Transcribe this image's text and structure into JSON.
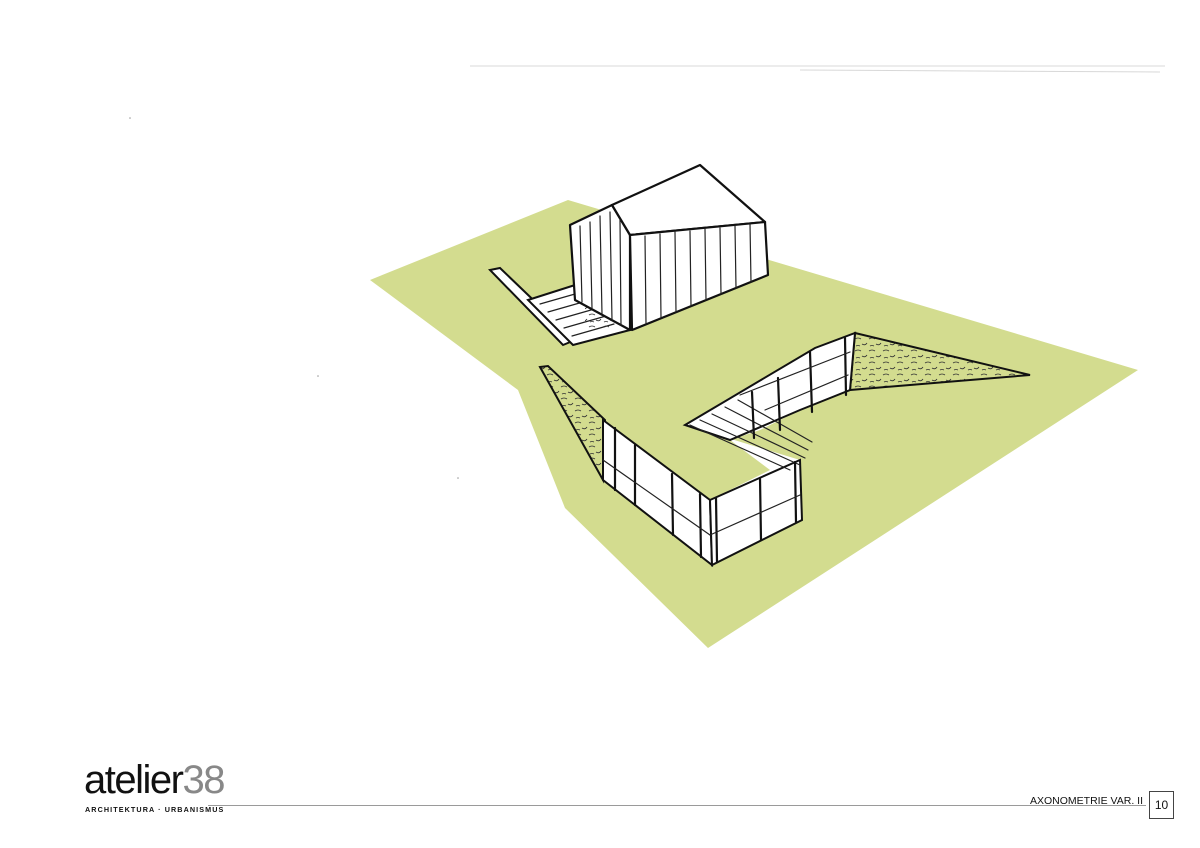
{
  "logo": {
    "word": "atelier",
    "number": "38",
    "subtitle": "ARCHITEKTURA · URBANISMUS"
  },
  "footer": {
    "title": "AXONOMETRIE VAR. II",
    "page_number": "10"
  },
  "colors": {
    "ground": "#d3dc8f",
    "ink": "#111111",
    "paper": "#ffffff"
  }
}
